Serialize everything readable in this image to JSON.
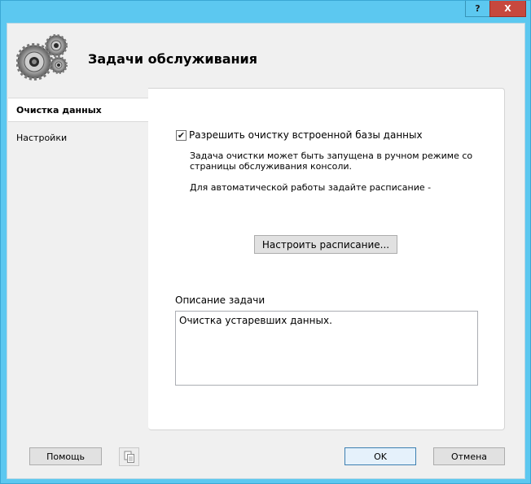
{
  "window": {
    "help_glyph": "?",
    "close_glyph": "X",
    "accent_color": "#5cc8f0"
  },
  "header": {
    "title": "Задачи обслуживания",
    "icon": "gears-icon"
  },
  "nav": {
    "items": [
      {
        "label": "Очистка данных",
        "selected": true
      },
      {
        "label": "Настройки",
        "selected": false
      }
    ]
  },
  "cleanup": {
    "enable_checkbox": {
      "label": "Разрешить очистку встроенной базы данных",
      "checked": true,
      "check_glyph": "✔"
    },
    "description_line1": "Задача очистки может быть запущена в ручном режиме со",
    "description_line2": "страницы обслуживания консоли.",
    "schedule_hint": "Для автоматической работы задайте расписание -",
    "schedule_button": "Настроить расписание...",
    "task_description_label": "Описание задачи",
    "task_description_value": "Очистка устаревших данных."
  },
  "footer": {
    "help_button": "Помощь",
    "copy_icon": "copy-icon",
    "ok_button": "OK",
    "cancel_button": "Отмена"
  }
}
